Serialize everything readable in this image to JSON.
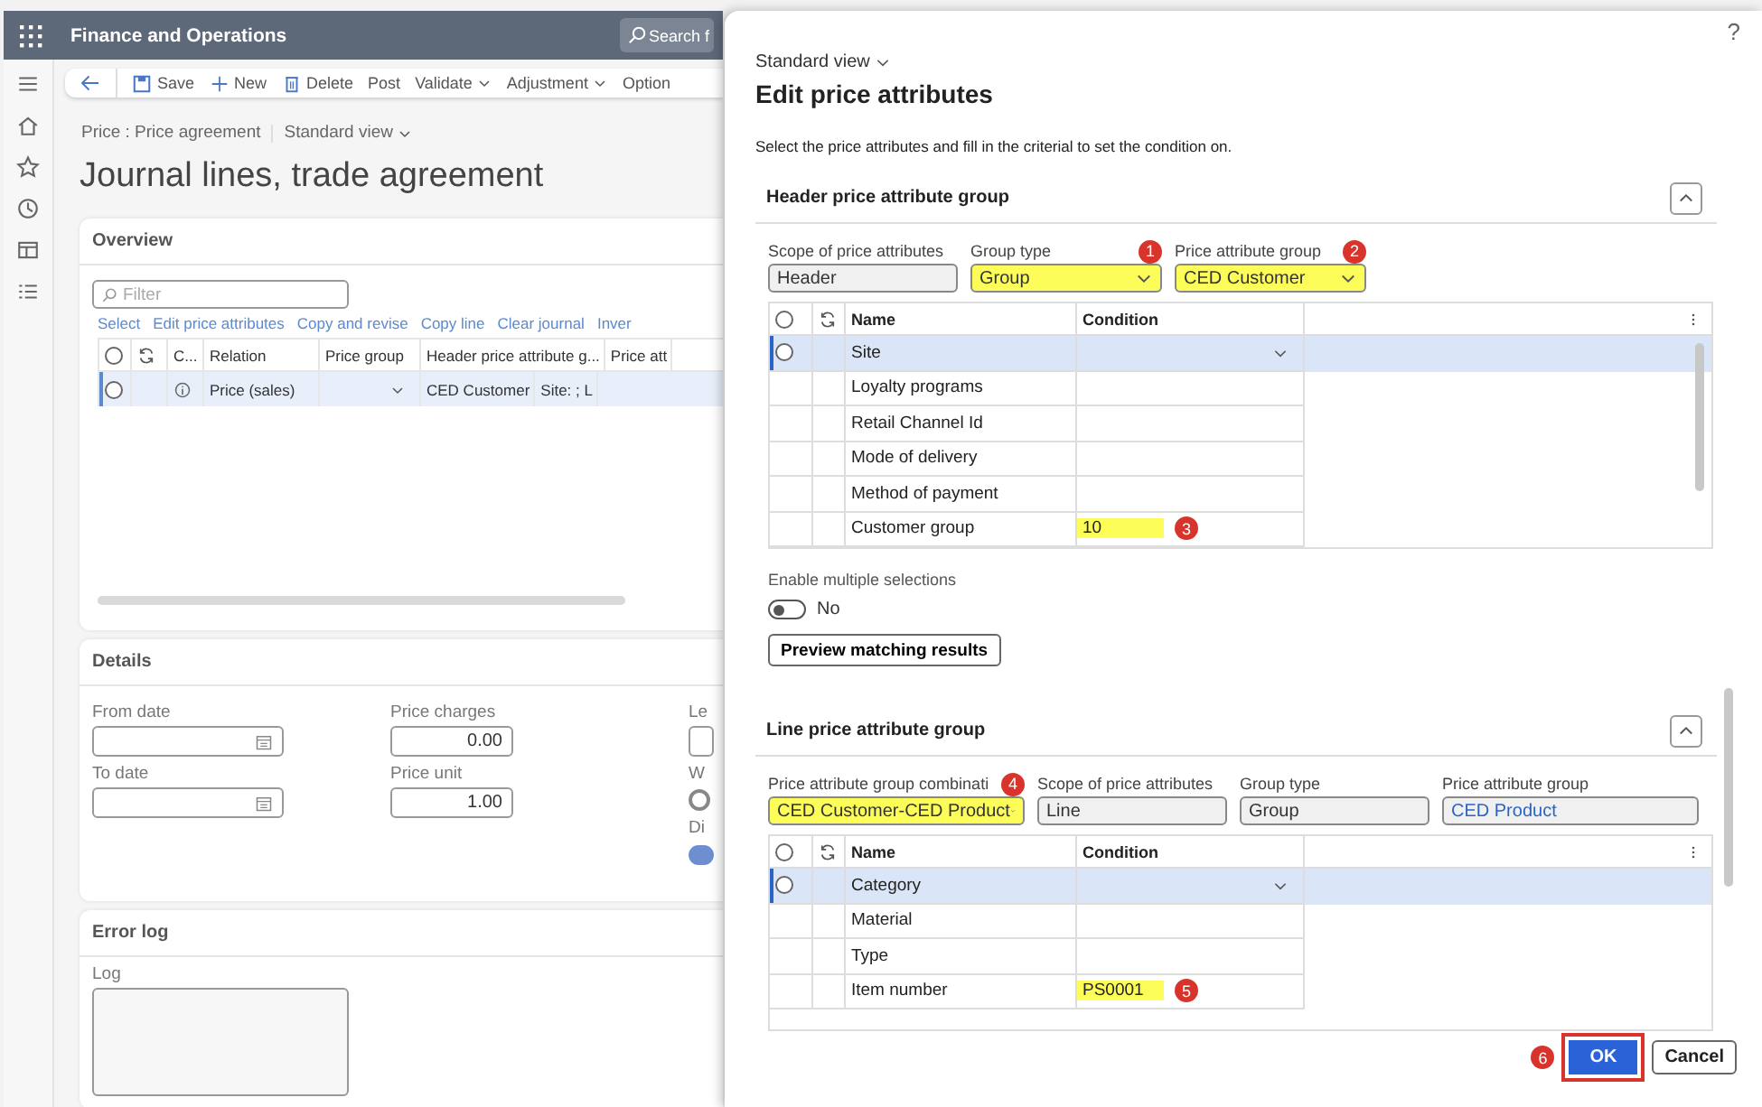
{
  "app": {
    "title": "Finance and Operations",
    "search_placeholder": "Search f"
  },
  "action_bar": [
    {
      "label": "Save",
      "kind": "save"
    },
    {
      "label": "New",
      "kind": "new"
    },
    {
      "label": "Delete",
      "kind": "delete"
    },
    {
      "label": "Post",
      "kind": "plain"
    },
    {
      "label": "Validate",
      "kind": "menu"
    },
    {
      "label": "Adjustment",
      "kind": "menu"
    },
    {
      "label": "Option",
      "kind": "plain"
    }
  ],
  "breadcrumb": {
    "path": "Price : Price agreement",
    "view": "Standard view"
  },
  "page_title": "Journal lines, trade agreement",
  "overview": {
    "title": "Overview",
    "filter_placeholder": "Filter",
    "links": [
      "Select",
      "Edit price attributes",
      "Copy and revise",
      "Copy line",
      "Clear journal",
      "Inver"
    ],
    "select_all": false,
    "columns": [
      "C...",
      "Relation",
      "Price group",
      "Header price attribute g...",
      "Price att"
    ],
    "rows": [
      {
        "selected": true,
        "relation": "Price (sales)",
        "header_group": "CED Customer",
        "price_attributes": "Site: ; L"
      }
    ]
  },
  "details": {
    "title": "Details",
    "columns": [
      [
        {
          "label": "From date",
          "kind": "date"
        },
        {
          "label": "To date",
          "kind": "date"
        }
      ],
      [
        {
          "label": "Price charges",
          "kind": "number",
          "value": "0.00"
        },
        {
          "label": "Price unit",
          "kind": "number",
          "value": "1.00"
        }
      ],
      [
        {
          "label": "Le",
          "kind": "text"
        },
        {
          "label": "W",
          "kind": "radio",
          "on": false
        },
        {
          "label": "Di",
          "kind": "toggle",
          "on": true
        }
      ]
    ]
  },
  "error_log": {
    "title": "Error log",
    "label": "Log"
  },
  "dialog": {
    "help": "?",
    "view": "Standard view",
    "title": "Edit price attributes",
    "description": "Select the price attributes and fill in the criterial to set the condition on.",
    "header_group": {
      "title": "Header price attribute group",
      "expanded": true,
      "fields": [
        {
          "label": "Scope of price attributes",
          "value": "Header",
          "kind": "readonly",
          "highlighted": false
        },
        {
          "label": "Group type",
          "value": "Group",
          "kind": "dropdown",
          "highlighted": true,
          "annotation": "1"
        },
        {
          "label": "Price attribute group",
          "value": "CED Customer",
          "kind": "dropdown",
          "highlighted": true,
          "annotation": "2"
        }
      ],
      "select_all": false,
      "columns": [
        "Name",
        "Condition"
      ],
      "rows": [
        {
          "name": "Site",
          "selected": true
        },
        {
          "name": "Loyalty programs",
          "selected": false
        },
        {
          "name": "Retail Channel Id",
          "selected": false
        },
        {
          "name": "Mode of delivery",
          "selected": false
        },
        {
          "name": "Method of payment",
          "selected": false
        },
        {
          "name": "Customer group",
          "selected": false,
          "condition": "10",
          "highlighted": true,
          "annotation": "3"
        }
      ]
    },
    "multiple_selections": {
      "label": "Enable multiple selections",
      "on": false,
      "state_text": "No"
    },
    "preview_button": "Preview matching results",
    "line_group": {
      "title": "Line price attribute group",
      "expanded": true,
      "fields": [
        {
          "label": "Price attribute group combinati",
          "value": "CED Customer-CED Product",
          "kind": "dropdown",
          "highlighted": true,
          "annotation": "4"
        },
        {
          "label": "Scope of price attributes",
          "value": "Line",
          "kind": "readonly",
          "highlighted": false
        },
        {
          "label": "Group type",
          "value": "Group",
          "kind": "readonly",
          "highlighted": false
        },
        {
          "label": "Price attribute group",
          "value": "CED Product",
          "kind": "reference",
          "highlighted": false
        }
      ],
      "select_all": false,
      "columns": [
        "Name",
        "Condition"
      ],
      "rows": [
        {
          "name": "Category",
          "selected": true
        },
        {
          "name": "Material",
          "selected": false
        },
        {
          "name": "Type",
          "selected": false
        },
        {
          "name": "Item number",
          "selected": false,
          "condition": "PS0001",
          "highlighted": true,
          "annotation": "5"
        }
      ]
    },
    "buttons": [
      {
        "label": "OK",
        "kind": "primary",
        "outlined": true,
        "annotation": "6"
      },
      {
        "label": "Cancel",
        "kind": "secondary",
        "outlined": false
      }
    ]
  }
}
